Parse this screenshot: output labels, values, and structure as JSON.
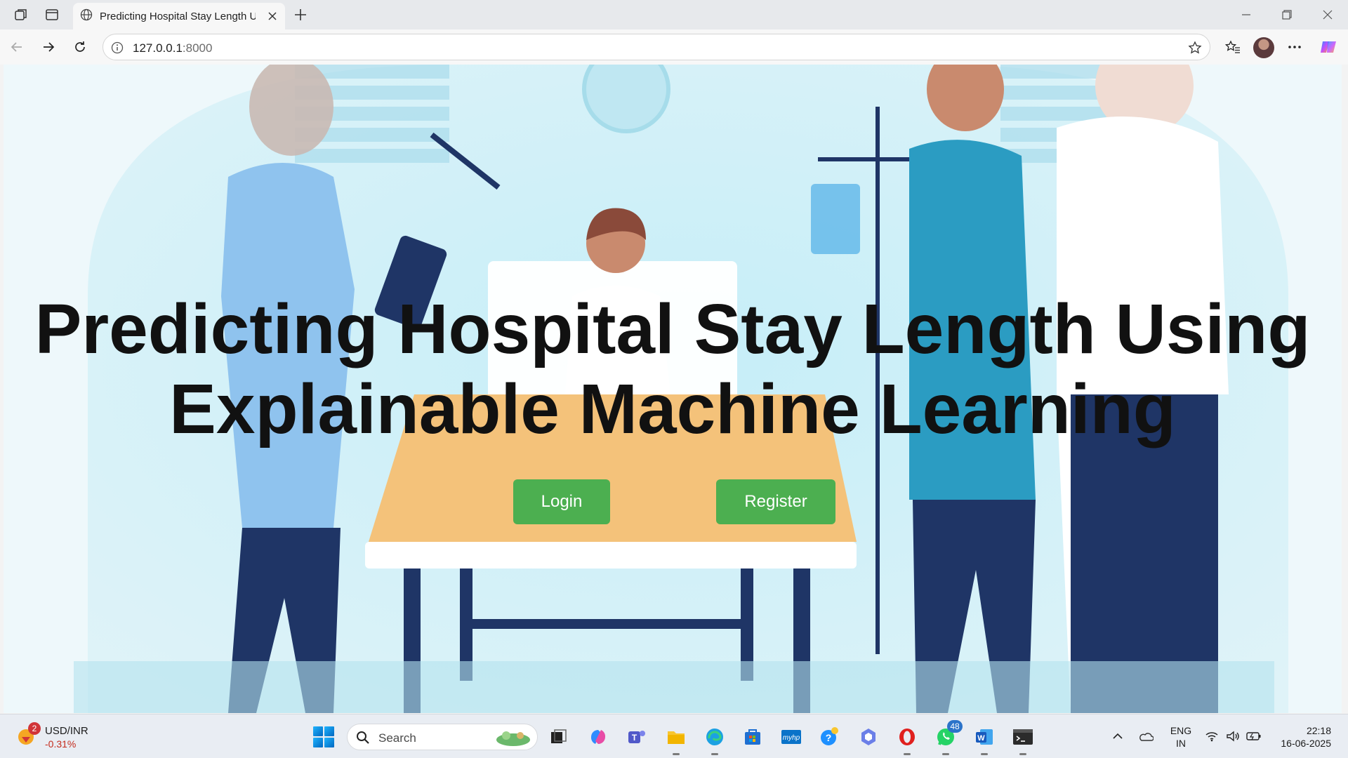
{
  "browser": {
    "tab_title": "Predicting Hospital Stay Length U",
    "url_host": "127.0.0.1",
    "url_port": ":8000"
  },
  "page": {
    "heading_line1": "Predicting Hospital Stay Length Using",
    "heading_line2": "Explainable Machine Learning",
    "login_label": "Login",
    "register_label": "Register",
    "button_color": "#4caf50"
  },
  "taskbar": {
    "widget_name": "USD/INR",
    "widget_change": "-0.31%",
    "widget_badge": "2",
    "search_label": "Search",
    "whatsapp_badge": "48",
    "lang_line1": "ENG",
    "lang_line2": "IN",
    "time": "22:18",
    "date": "16-06-2025",
    "icons": [
      "start-icon",
      "search-icon",
      "task-view-icon",
      "copilot-icon",
      "teams-icon",
      "file-explorer-icon",
      "edge-icon",
      "store-icon",
      "myhp-icon",
      "help-icon",
      "copilot-app-icon",
      "opera-icon",
      "whatsapp-icon",
      "word-icon",
      "terminal-icon"
    ]
  }
}
